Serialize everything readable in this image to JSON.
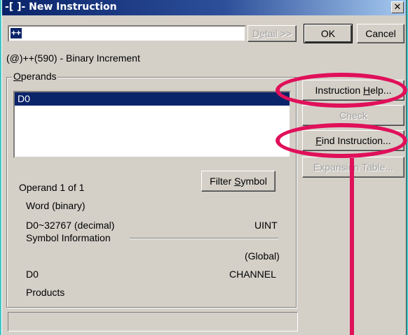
{
  "window": {
    "title": "-[ ]- New Instruction",
    "close_glyph": "✕"
  },
  "instruction_input": {
    "value": "++"
  },
  "buttons": {
    "detail": {
      "prefix": "D",
      "underlined": "e",
      "suffix": "tail >>"
    },
    "ok": "OK",
    "cancel": "Cancel",
    "instruction_help": {
      "prefix": "Instruction ",
      "underlined": "H",
      "suffix": "elp..."
    },
    "check": "Check",
    "find_instruction": {
      "prefix": "",
      "underlined": "F",
      "suffix": "ind Instruction..."
    },
    "expansion_table": "Expansion Table...",
    "filter_symbol": {
      "prefix": "Filter ",
      "underlined": "S",
      "suffix": "ymbol"
    }
  },
  "instruction_description": "(@)++(590) - Binary Increment",
  "operands": {
    "group_label": {
      "underlined": "O",
      "suffix": "perands"
    },
    "items": [
      "D0"
    ],
    "count_text": "Operand 1 of 1",
    "type": "Word (binary)",
    "range": "D0~32767 (decimal)",
    "data_type": "UINT"
  },
  "symbol_information": {
    "label": "Symbol Information",
    "scope": "(Global)",
    "name": "D0",
    "kind": "CHANNEL",
    "comment": "Products"
  },
  "status_bar": {
    "text": ""
  },
  "annotation_colors": {
    "highlight": "#e0105a"
  }
}
